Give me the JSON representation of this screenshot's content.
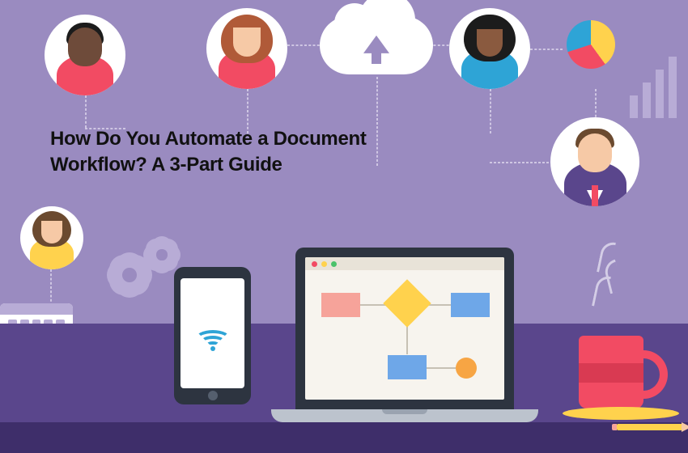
{
  "heading": {
    "line1": "How Do You Automate a Document",
    "line2": "Workflow? A 3-Part Guide"
  },
  "icons": {
    "cloud": "cloud-upload",
    "wifi": "wifi",
    "pie": "pie-chart",
    "bars": "bar-chart",
    "gear": "gear",
    "calendar": "calendar"
  },
  "colors": {
    "background": "#9a8bc0",
    "desk": "#5a468c",
    "accent_red": "#f24b63",
    "accent_yellow": "#ffd24d",
    "accent_blue": "#2ea4d6"
  }
}
